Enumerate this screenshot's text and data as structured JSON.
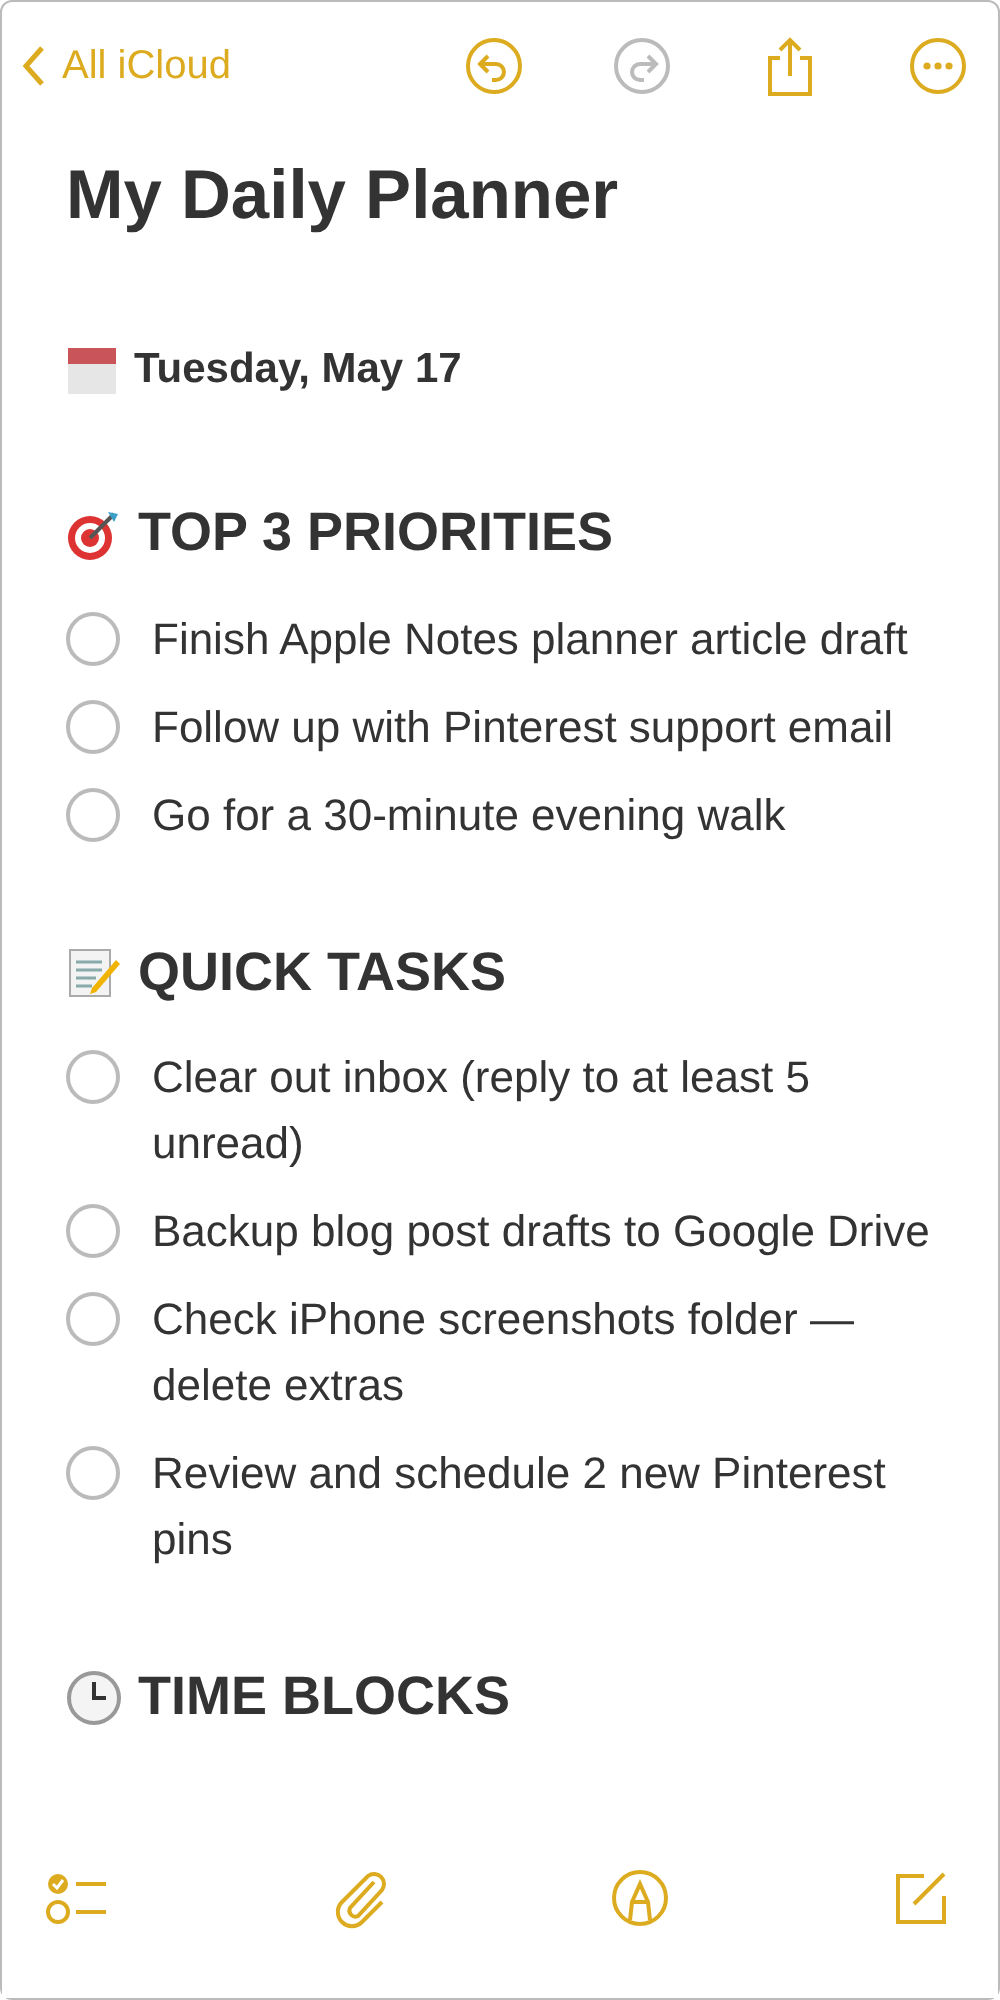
{
  "nav": {
    "back": "All iCloud",
    "actions": [
      {
        "kind": "undo",
        "disabled": false
      },
      {
        "kind": "redo",
        "disabled": true
      },
      {
        "kind": "share",
        "disabled": false
      },
      {
        "kind": "more",
        "disabled": false
      }
    ]
  },
  "note": {
    "title": "My Daily Planner",
    "date": {
      "kind": "calendar",
      "text": "Tuesday, May 17"
    },
    "sections": [
      {
        "kind": "target",
        "heading": "TOP 3 PRIORITIES",
        "tasks": [
          {
            "text": "Finish Apple Notes planner article draft",
            "checked": false
          },
          {
            "text": "Follow up with Pinterest support email",
            "checked": false
          },
          {
            "text": "Go for a 30-minute evening walk",
            "checked": false
          }
        ]
      },
      {
        "kind": "memo",
        "heading": "QUICK TASKS",
        "tasks": [
          {
            "text": "Clear out inbox (reply to at least 5 unread)",
            "checked": false
          },
          {
            "text": "Backup blog post drafts to Google Drive",
            "checked": false
          },
          {
            "text": "Check iPhone screenshots folder — delete extras",
            "checked": false
          },
          {
            "text": "Review and schedule 2 new Pinterest pins",
            "checked": false
          }
        ]
      },
      {
        "kind": "clock",
        "heading": "TIME BLOCKS"
      }
    ]
  },
  "toolbar": [
    {
      "kind": "checklist"
    },
    {
      "kind": "attach"
    },
    {
      "kind": "markup"
    },
    {
      "kind": "compose"
    }
  ]
}
